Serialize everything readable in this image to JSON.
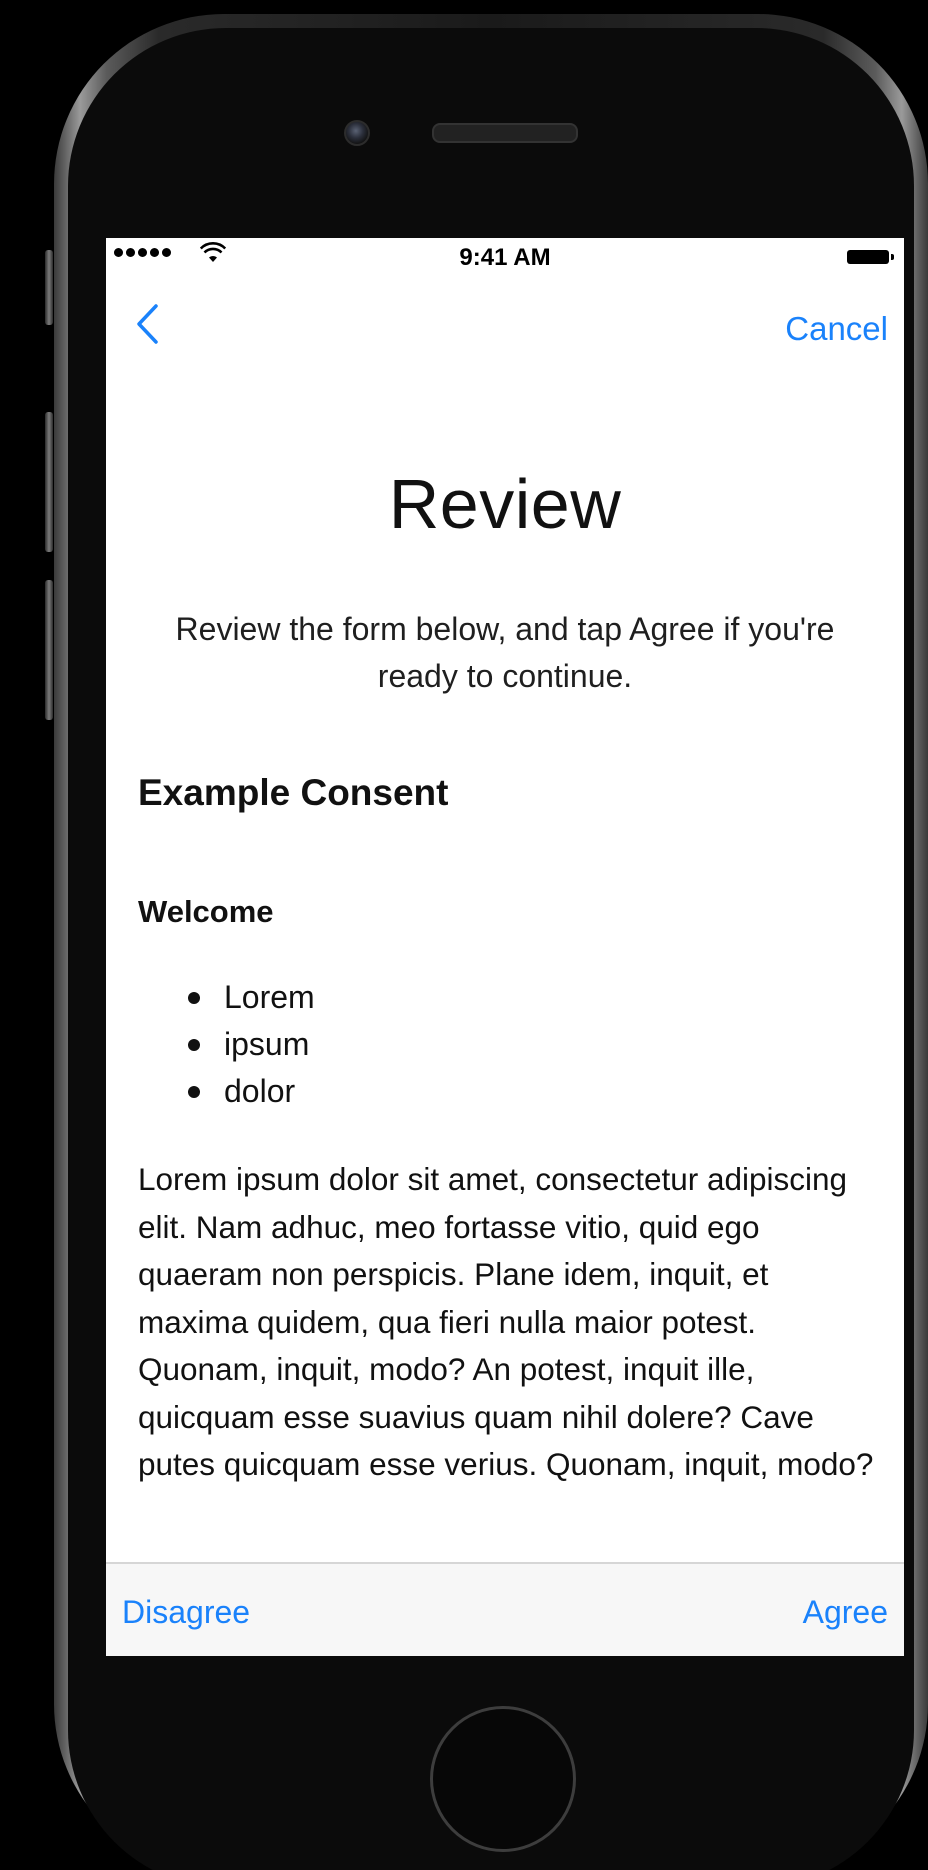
{
  "status_bar": {
    "time": "9:41 AM"
  },
  "nav_bar": {
    "cancel_label": "Cancel"
  },
  "main": {
    "title": "Review",
    "subtitle": "Review the form below, and tap Agree if you're ready to continue.",
    "section_heading": "Example Consent",
    "sub_heading": "Welcome",
    "bullets": [
      "Lorem",
      "ipsum",
      "dolor"
    ],
    "body": "Lorem ipsum dolor sit amet, consectetur adipiscing elit. Nam adhuc, meo fortasse vitio, quid ego quaeram non perspicis. Plane idem, inquit, et maxima quidem, qua fieri nulla maior potest. Quonam, inquit, modo? An potest, inquit ille, quicquam esse suavius quam nihil dolere? Cave putes quicquam esse verius. Quonam, inquit, modo?"
  },
  "toolbar": {
    "disagree_label": "Disagree",
    "agree_label": "Agree"
  },
  "colors": {
    "accent": "#1a82fb",
    "screen_background": "#ffffff",
    "toolbar_background": "#f7f7f7",
    "device_background": "#000000"
  },
  "icons": {
    "back": "chevron-left-icon",
    "wifi": "wifi-icon",
    "battery": "battery-icon",
    "signal": "signal-dots-icon"
  }
}
